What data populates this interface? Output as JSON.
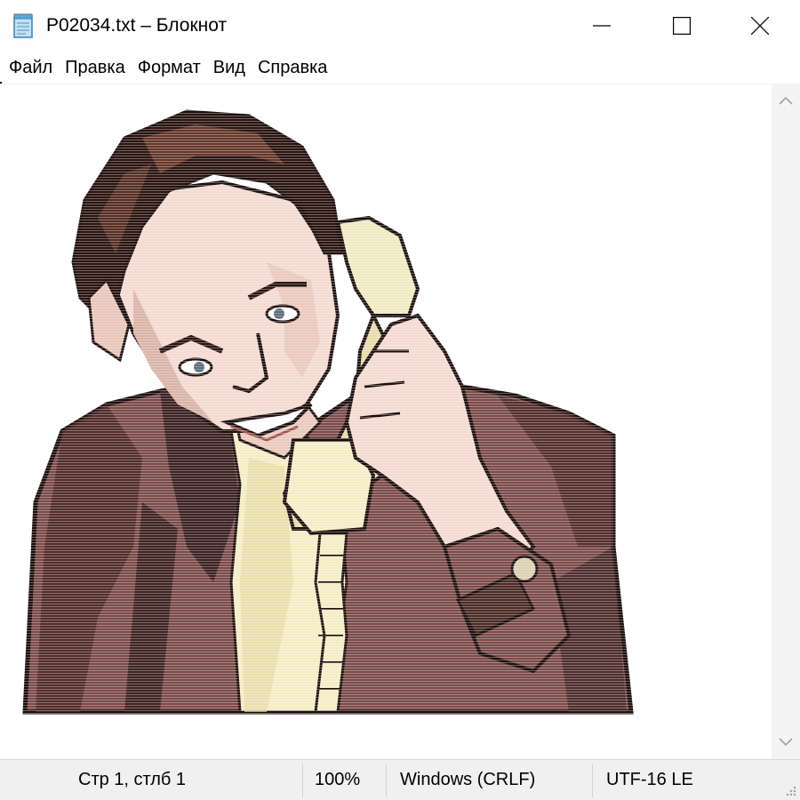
{
  "window": {
    "title": "P02034.txt – Блокнот",
    "app_icon": "notepad-icon"
  },
  "caption_buttons": {
    "minimize_icon": "minimize-icon",
    "maximize_icon": "maximize-icon",
    "close_icon": "close-icon"
  },
  "menu": {
    "items": [
      {
        "label": "Файл"
      },
      {
        "label": "Правка"
      },
      {
        "label": "Формат"
      },
      {
        "label": "Вид"
      },
      {
        "label": "Справка"
      }
    ]
  },
  "editor": {
    "content_description_icon": "ascii-art-man-on-phone"
  },
  "scrollbar": {
    "up_icon": "chevron-up-icon",
    "down_icon": "chevron-down-icon"
  },
  "status": {
    "position": "Стр 1, стлб 1",
    "zoom": "100%",
    "line_ending": "Windows (CRLF)",
    "encoding": "UTF-16 LE"
  },
  "colors": {
    "jacket": "#7a4a48",
    "jacket_shadow": "#3a1f1f",
    "skin": "#f3d9d0",
    "shirt": "#f4ecc4",
    "phone": "#f0e9c0",
    "hair": "#2a1410",
    "outline": "#1a0d0b"
  }
}
